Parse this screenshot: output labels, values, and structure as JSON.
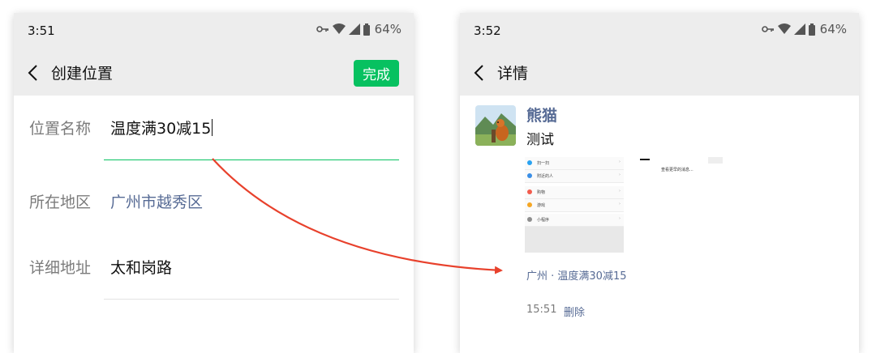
{
  "left": {
    "status": {
      "time": "3:51",
      "battery": "64%"
    },
    "nav": {
      "title": "创建位置",
      "done": "完成"
    },
    "fields": [
      {
        "label": "位置名称",
        "value": "温度满30减15"
      },
      {
        "label": "所在地区",
        "value": "广州市越秀区"
      },
      {
        "label": "详细地址",
        "value": "太和岗路"
      }
    ]
  },
  "right": {
    "status": {
      "time": "3:52",
      "battery": "64%"
    },
    "nav": {
      "title": "详情"
    },
    "post": {
      "name": "熊猫",
      "text": "测试",
      "location": "广州 · 温度满30减15",
      "time": "15:51",
      "delete": "删除"
    },
    "thumbnail": {
      "menu": [
        "扫一扫",
        "附近的人",
        "购物",
        "游戏",
        "小程序"
      ],
      "menu_colors": [
        "#2aa3f1",
        "#3a8ee6",
        "#f25c4d",
        "#f5a623",
        "#8e8e8e"
      ],
      "side_text": "查看更早的消息..."
    }
  },
  "colors": {
    "accent": "#07c160",
    "link": "#576b95",
    "arrow": "#e8412c"
  }
}
